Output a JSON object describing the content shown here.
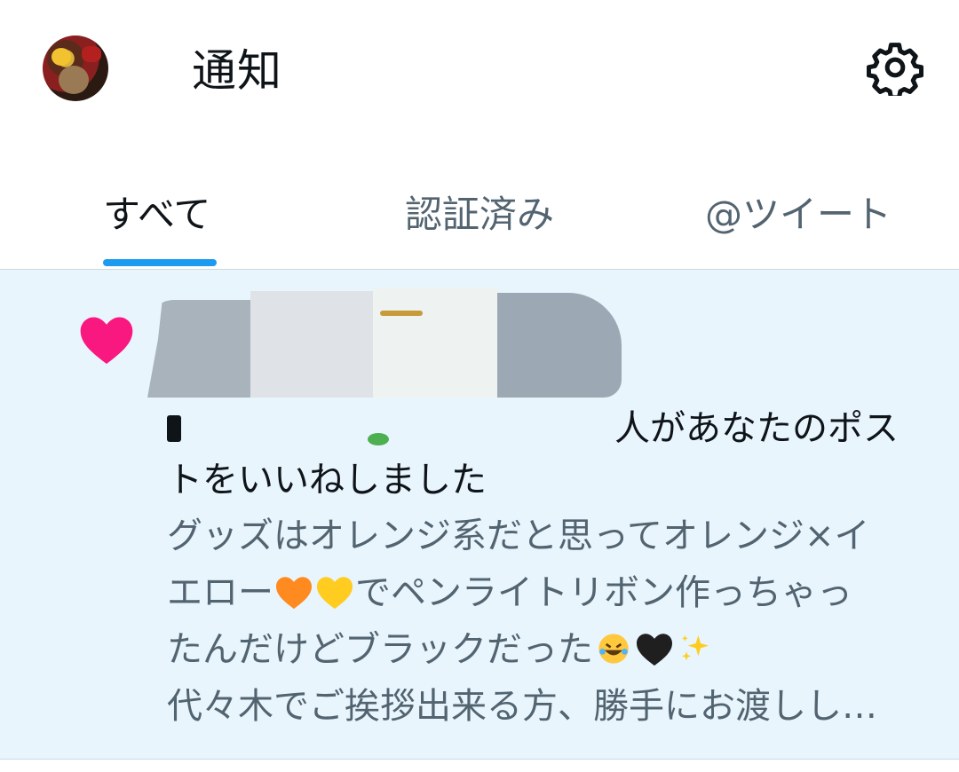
{
  "header": {
    "title": "通知"
  },
  "tabs": [
    {
      "label": "すべて",
      "active": true
    },
    {
      "label": "認証済み",
      "active": false
    },
    {
      "label": "@ツイート",
      "active": false
    }
  ],
  "notification": {
    "type": "like",
    "action_text": "人があなたのポストをいいねしました",
    "post_line1": "グッズはオレンジ系だと思ってオレンジ×イ",
    "post_line2a": "エロー",
    "post_line2b": "でペンライトリボン作っちゃっ",
    "post_line3": "たんだけどブラックだった",
    "post_line4": "代々木でご挨拶出来る方、勝手にお渡しし…"
  },
  "colors": {
    "accent": "#1d9bf0",
    "like_heart": "#f91880",
    "notification_bg": "#e8f5fd"
  },
  "icons": {
    "settings": "gear-icon",
    "like": "heart-icon"
  }
}
